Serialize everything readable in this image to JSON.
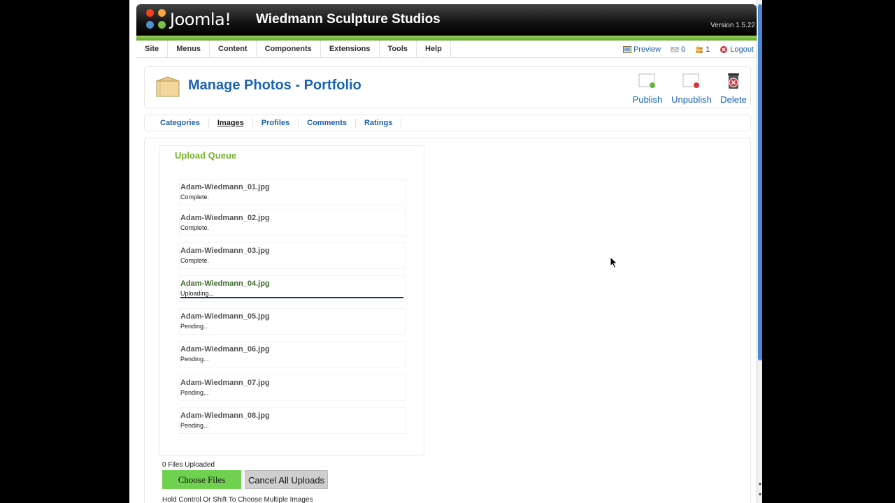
{
  "header": {
    "logo_text": "Joomla!",
    "site_name": "Wiedmann Sculpture Studios",
    "version": "Version 1.5.22"
  },
  "menu": {
    "items": [
      "Site",
      "Menus",
      "Content",
      "Components",
      "Extensions",
      "Tools",
      "Help"
    ],
    "preview": "Preview",
    "messages_count": "0",
    "users_count": "1",
    "logout": "Logout"
  },
  "toolbar": {
    "title": "Manage Photos - Portfolio",
    "publish": "Publish",
    "unpublish": "Unpublish",
    "delete": "Delete"
  },
  "tabs": {
    "items": [
      "Categories",
      "Images",
      "Profiles",
      "Comments",
      "Ratings"
    ],
    "active": "Images"
  },
  "queue": {
    "title": "Upload Queue",
    "files": [
      {
        "name": "Adam-Wiedmann_01.jpg",
        "status": "Complete."
      },
      {
        "name": "Adam-Wiedmann_02.jpg",
        "status": "Complete."
      },
      {
        "name": "Adam-Wiedmann_03.jpg",
        "status": "Complete."
      },
      {
        "name": "Adam-Wiedmann_04.jpg",
        "status": "Uploading..."
      },
      {
        "name": "Adam-Wiedmann_05.jpg",
        "status": "Pending..."
      },
      {
        "name": "Adam-Wiedmann_06.jpg",
        "status": "Pending..."
      },
      {
        "name": "Adam-Wiedmann_07.jpg",
        "status": "Pending..."
      },
      {
        "name": "Adam-Wiedmann_08.jpg",
        "status": "Pending..."
      }
    ],
    "uploaded_count": "0 Files Uploaded",
    "choose_files": "Choose Files",
    "cancel_all": "Cancel All Uploads",
    "hint": "Hold Control Or Shift To Choose Multiple Images"
  },
  "colors": {
    "accent_green": "#79b32b",
    "link_blue": "#1a64b4",
    "progress_bar": "#1b2f8a"
  }
}
